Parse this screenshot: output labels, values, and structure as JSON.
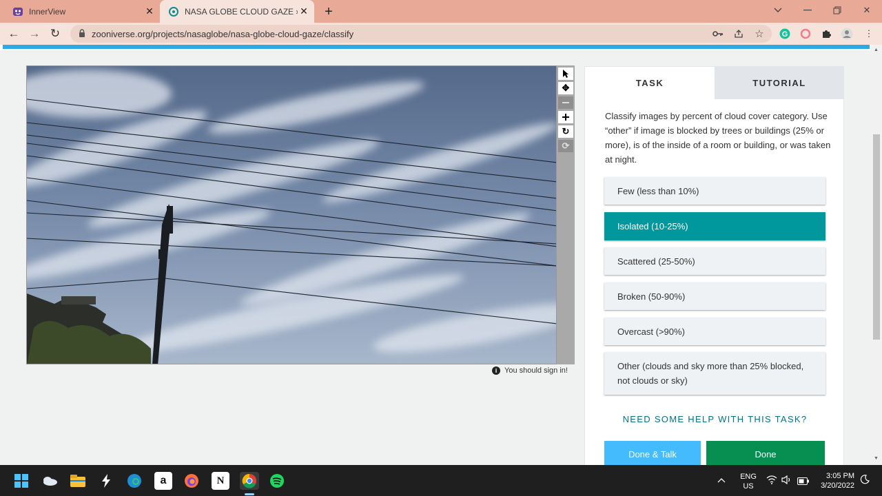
{
  "browser": {
    "tabs": [
      {
        "title": "InnerView",
        "favicon": "innerview-icon"
      },
      {
        "title": "NASA GLOBE CLOUD GAZE » Cla",
        "favicon": "zooniverse-icon",
        "active": true
      }
    ],
    "url": "zooniverse.org/projects/nasaglobe/nasa-globe-cloud-gaze/classify"
  },
  "subject": {
    "tools": [
      "pointer-icon",
      "move-icon",
      "zoom-out-icon",
      "zoom-in-icon",
      "rotate-icon",
      "reset-icon"
    ],
    "sign_in_notice": "You should sign in!"
  },
  "task_panel": {
    "tab_task": "TASK",
    "tab_tutorial": "TUTORIAL",
    "instructions": "Classify images by percent of cloud cover category. Use “other” if image is blocked by trees or buildings (25% or more), is of the inside of a room or building, or was taken at night.",
    "answers": [
      {
        "label": "Few (less than 10%)",
        "selected": false
      },
      {
        "label": "Isolated (10-25%)",
        "selected": true
      },
      {
        "label": "Scattered (25-50%)",
        "selected": false
      },
      {
        "label": "Broken (50-90%)",
        "selected": false
      },
      {
        "label": "Overcast (>90%)",
        "selected": false
      },
      {
        "label": "Other (clouds and sky more than 25% blocked, not clouds or sky)",
        "selected": false
      }
    ],
    "help_link": "NEED SOME HELP WITH THIS TASK?",
    "done_talk": "Done & Talk",
    "done": "Done"
  },
  "taskbar": {
    "lang_top": "ENG",
    "lang_bottom": "US",
    "time": "3:05 PM",
    "date": "3/20/2022"
  },
  "colors": {
    "tabstrip": "#e8a996",
    "accent_blue": "#2fa8e8",
    "selected_answer": "#00979d",
    "done_green": "#078f52",
    "done_talk_blue": "#43bbfd"
  }
}
